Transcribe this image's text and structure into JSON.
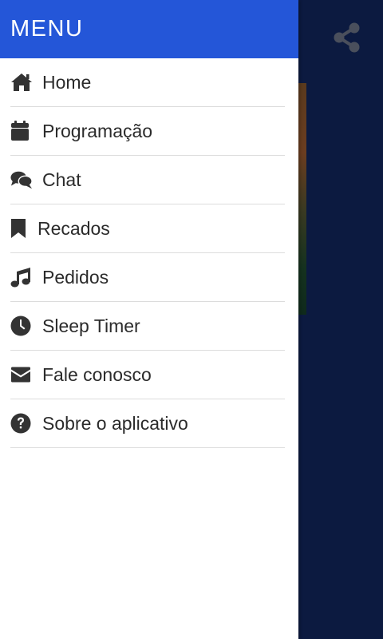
{
  "drawer": {
    "title": "MENU",
    "header_color": "#2456d8",
    "items": [
      {
        "label": "Home",
        "icon": "home-icon"
      },
      {
        "label": "Programação",
        "icon": "calendar-icon"
      },
      {
        "label": "Chat",
        "icon": "chat-bubbles-icon"
      },
      {
        "label": "Recados",
        "icon": "bookmark-icon"
      },
      {
        "label": "Pedidos",
        "icon": "music-note-icon"
      },
      {
        "label": "Sleep Timer",
        "icon": "clock-icon"
      },
      {
        "label": "Fale conosco",
        "icon": "envelope-icon"
      },
      {
        "label": "Sobre o aplicativo",
        "icon": "question-circle-icon"
      }
    ]
  },
  "background_app": {
    "background_color": "#0c1a40",
    "share_icon": "share-icon"
  }
}
